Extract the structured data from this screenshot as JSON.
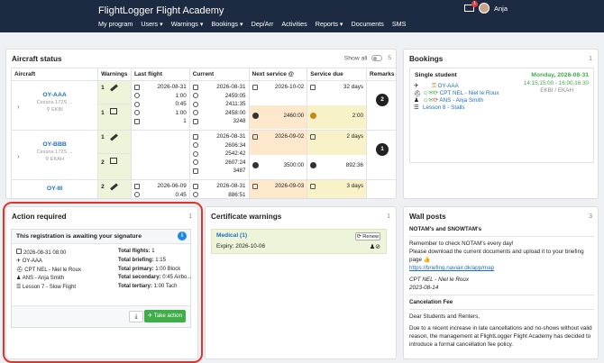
{
  "app": {
    "title": "FlightLogger Flight Academy",
    "nav": [
      "My program",
      "Users",
      "Warnings",
      "Bookings",
      "Dep/Arr",
      "Activities",
      "Reports",
      "Documents",
      "SMS"
    ],
    "user_name": "Anja",
    "mail_badge": "1"
  },
  "aircraft_status": {
    "title": "Aircraft status",
    "show_all_label": "Show all",
    "count": "5",
    "columns": [
      "Aircraft",
      "Warnings",
      "Last flight",
      "Current",
      "Next service @",
      "Service due",
      "Remarks"
    ],
    "rows": [
      {
        "name": "OY-AAA",
        "model": "Cessna 172S ...",
        "base": "EKBI",
        "warnings": [
          "1",
          "1"
        ],
        "last_flight": [
          "2026-08-31",
          "1:00",
          "0:45",
          "1:00",
          "1"
        ],
        "current": [
          "2026-08-31",
          "2459:05",
          "2411:35",
          "2458:00",
          "3248"
        ],
        "next_service": [
          "2026-10-02",
          "2460:00"
        ],
        "service_due": [
          "32 days",
          "2:00"
        ],
        "remarks": "2"
      },
      {
        "name": "OY-BBB",
        "model": "Cessna 172S ...",
        "base": "EKAH",
        "warnings": [
          "1",
          "2"
        ],
        "last_flight": [],
        "current": [
          "2026-08-31",
          "2606:34",
          "2542:42",
          "2607:24",
          "3487"
        ],
        "next_service": [
          "2026-09-02",
          "3500:00"
        ],
        "service_due": [
          "2 days",
          "892:36"
        ],
        "remarks": "1"
      },
      {
        "name": "OY-III",
        "model": "",
        "base": "",
        "warnings": [
          "2"
        ],
        "last_flight": [
          "2026-06-09",
          "0:45"
        ],
        "current": [
          "2026-08-31",
          "886:51"
        ],
        "next_service": [
          "2026-09-03"
        ],
        "service_due": [
          "3 days"
        ],
        "remarks": ""
      }
    ]
  },
  "bookings": {
    "title": "Bookings",
    "count": "1",
    "type": "Single student",
    "date": "Monday, 2026-08-31",
    "time": "14:15,15:00 - 16:00,16:30",
    "route": "EKBI / EKAH",
    "aircraft": "OY-AAA",
    "instructor": "CPT NEL - Niel le Roux",
    "student": "ANS - Anja Smith",
    "lesson": "Lesson 8 - Stalls"
  },
  "action_required": {
    "title": "Action required",
    "count": "1",
    "card_title": "This registration is awaiting your signature",
    "left": [
      "2026-08-31 08:00",
      "OY-AAA",
      "CPT NEL - Niel le Roux",
      "ANS - Anja Smith",
      "Lesson 7 - Slow Flight"
    ],
    "right": [
      {
        "label": "Total flights:",
        "value": "1"
      },
      {
        "label": "Total briefing:",
        "value": "1:15"
      },
      {
        "label": "Total primary:",
        "value": "1:00 Block"
      },
      {
        "label": "Total secondary:",
        "value": "0:45 Airbo..."
      },
      {
        "label": "Total tertiary:",
        "value": "1:00 Tach"
      }
    ],
    "take_action": "Take action"
  },
  "certificate_warnings": {
    "title": "Certificate warnings",
    "count": "1",
    "name": "Medical (1)",
    "expiry": "Expiry: 2026-10-06",
    "renew": "Renew"
  },
  "wall_posts": {
    "title": "Wall posts",
    "count": "3",
    "post1_title": "NOTAM's and SNOWTAM's",
    "post1_l1": "Remember to check NOTAM's every day!",
    "post1_l2": "Please download the current documents and upload it to your briefing page 👍",
    "post1_link": "https://briefing.naviair.dk/app/map",
    "post1_author": "CPT NEL - Niel le Roux",
    "post1_date": "2023-08-14",
    "post2_title": "Cancelation Fee",
    "post2_l1": "Dear Students and Renters,",
    "post2_l2": "Due to a recent increase in late cancellations and no-shows without valid reason, the management at FlightLogger Flight Academy has decided to introduce a formal cancellation fee policy."
  }
}
